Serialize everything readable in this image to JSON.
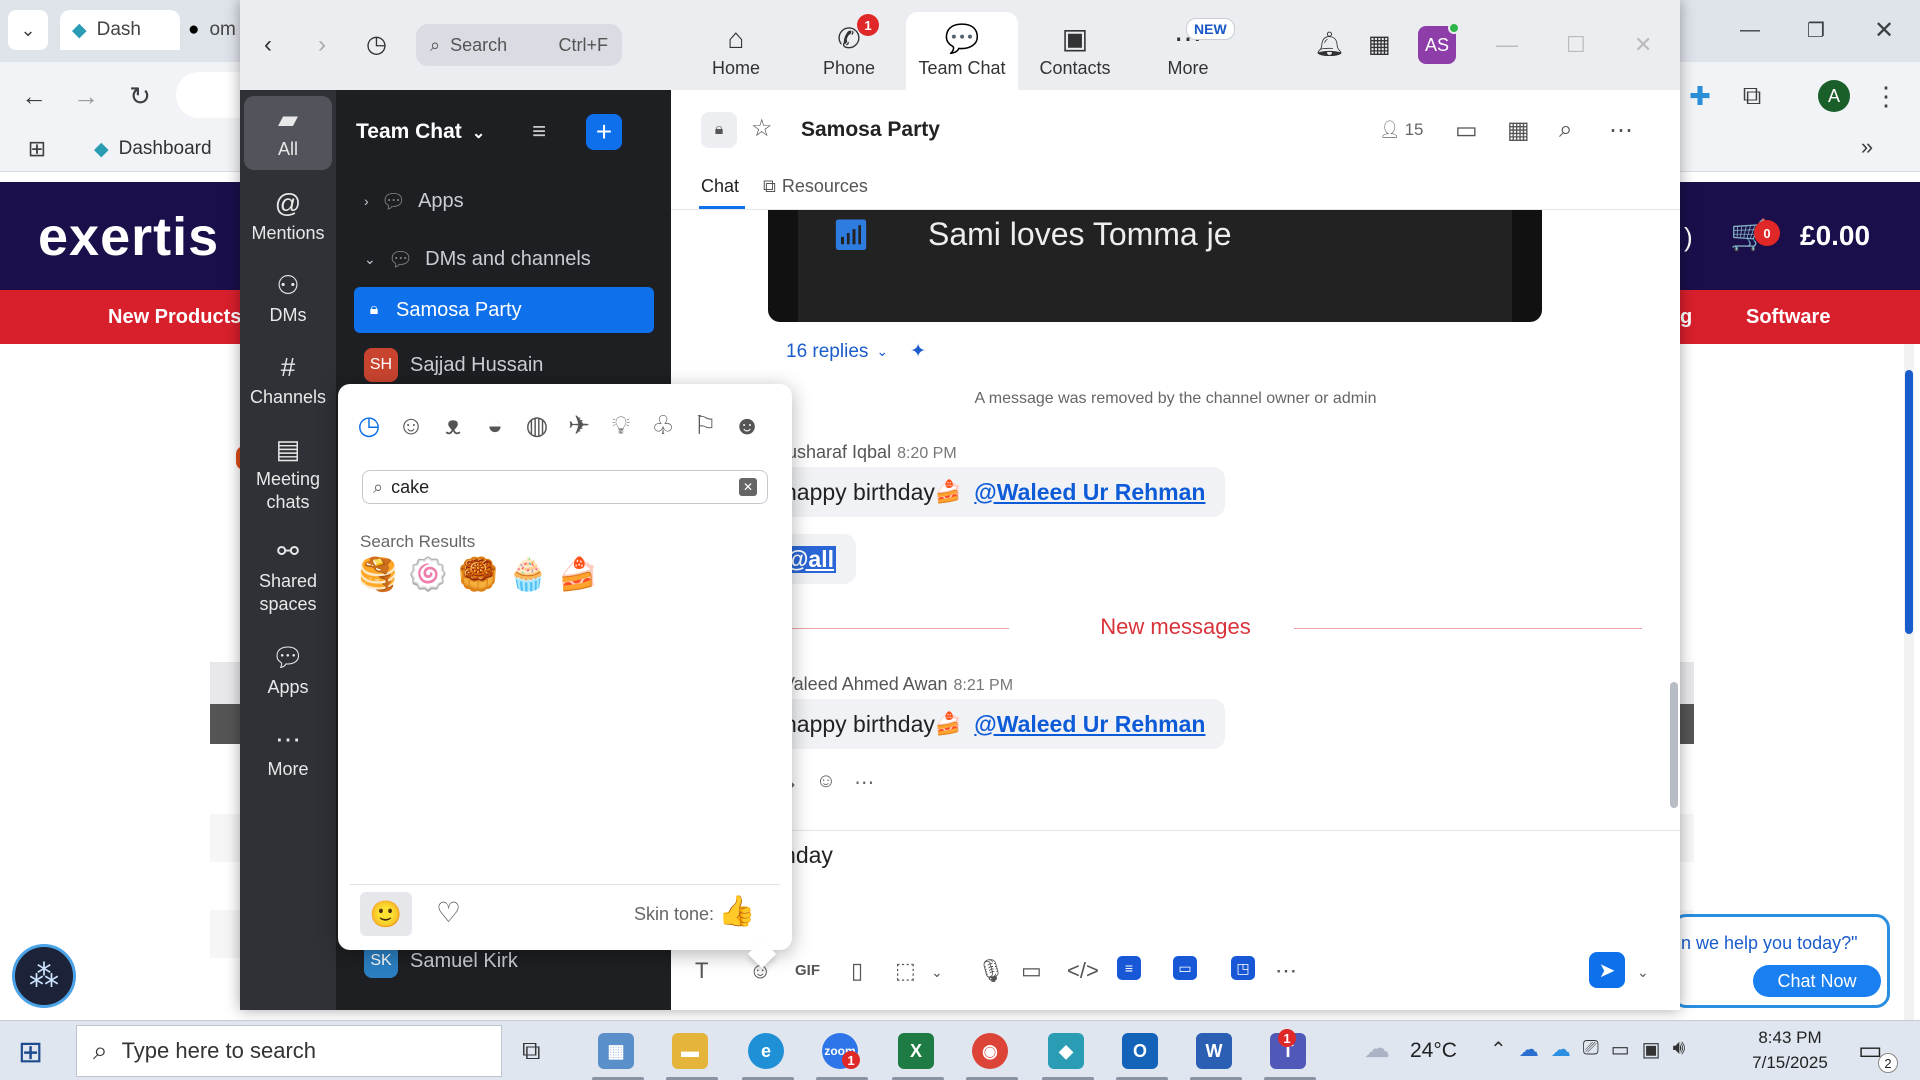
{
  "browser": {
    "tabs": [
      {
        "label": "Dash"
      },
      {
        "label": "om"
      }
    ],
    "bookmark": "Dashboard",
    "profile_initial": "A"
  },
  "website": {
    "logo": "exertis",
    "cart_count": "0",
    "cart_total": "£0.00",
    "nav_left": "New Products",
    "nav_right": "Software",
    "nav_partial": "g",
    "partial_paren": ")",
    "chat_bubble_text": "n we help you today?\"",
    "chat_now": "Chat Now"
  },
  "zoom": {
    "search_placeholder": "Search",
    "search_shortcut": "Ctrl+F",
    "nav_tabs": [
      {
        "label": "Home",
        "icon": "home-icon"
      },
      {
        "label": "Phone",
        "icon": "phone-icon",
        "badge": "1"
      },
      {
        "label": "Team Chat",
        "icon": "chat-icon"
      },
      {
        "label": "Contacts",
        "icon": "contacts-icon"
      },
      {
        "label": "More",
        "icon": "more-icon",
        "badge": "NEW"
      }
    ],
    "user_initials": "AS",
    "rail": [
      {
        "label": "All"
      },
      {
        "label": "Mentions"
      },
      {
        "label": "DMs"
      },
      {
        "label": "Channels"
      },
      {
        "label": "Meeting chats"
      },
      {
        "label": "Shared spaces"
      },
      {
        "label": "Apps"
      },
      {
        "label": "More"
      }
    ],
    "list": {
      "title": "Team Chat",
      "section_apps": "Apps",
      "section_dms": "DMs and channels",
      "items": [
        {
          "label": "Samosa Party"
        },
        {
          "label": "Sajjad Hussain",
          "initials": "SH"
        },
        {
          "label": "Samuel Kirk",
          "initials": "SK"
        }
      ]
    },
    "conversation": {
      "title": "Samosa Party",
      "member_count": "15",
      "tabs": [
        "Chat",
        "Resources"
      ],
      "image_text": "Sami loves Tomma je",
      "replies": "16 replies",
      "removed_notice": "A message was removed by the channel owner or admin",
      "messages": [
        {
          "sender": "lusharaf Iqbal",
          "time": "8:20 PM",
          "text": "happy birthday",
          "mention": "@Waleed Ur Rehman"
        },
        {
          "mention_all": "@all"
        },
        {
          "sender": "Valeed Ahmed Awan",
          "time": "8:21 PM",
          "text": "happy birthday",
          "mention": "@Waleed Ur Rehman"
        }
      ],
      "new_messages": "New messages",
      "composer_text": "rthday"
    },
    "emoji_picker": {
      "search_value": "cake",
      "results_label": "Search Results",
      "results": [
        "🥞",
        "🍥",
        "🥮",
        "🧁",
        "🍰"
      ],
      "skin_tone_label": "Skin tone:",
      "skin_tone_emoji": "👍",
      "footer_emoji": "🙂"
    }
  },
  "taskbar": {
    "search_placeholder": "Type here to search",
    "weather": "24°C",
    "time": "8:43 PM",
    "date": "7/15/2025",
    "notif_count": "2",
    "zoom_badge": "1",
    "teams_badge": "1"
  },
  "colors": {
    "accent": "#0e71eb",
    "site_header": "#1a0f4a",
    "site_nav": "#d81f2c",
    "new_messages": "#d9333a"
  }
}
